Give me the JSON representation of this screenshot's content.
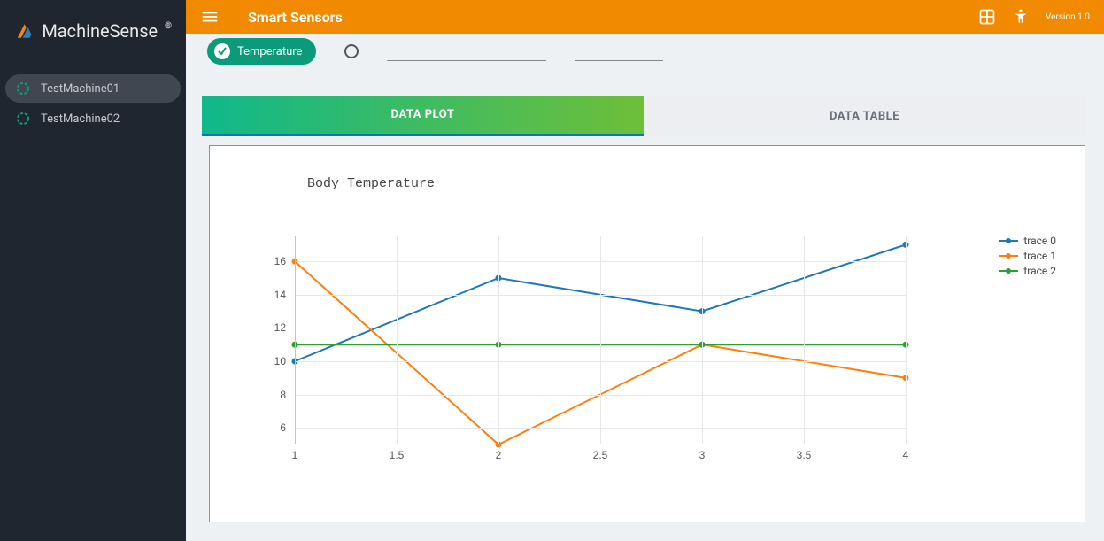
{
  "brand": "MachineSense",
  "header": {
    "title": "Smart Sensors",
    "version": "Version 1.0"
  },
  "sidebar": {
    "items": [
      {
        "label": "TestMachine01",
        "active": true
      },
      {
        "label": "TestMachine02",
        "active": false
      }
    ]
  },
  "subheader": {
    "chip_label": "Temperature",
    "field1": "",
    "field2": ""
  },
  "tabs": [
    {
      "label": "DATA PLOT",
      "active": true
    },
    {
      "label": "DATA TABLE",
      "active": false
    }
  ],
  "chart_data": {
    "type": "line",
    "title": "Body Temperature",
    "xlabel": "",
    "ylabel": "",
    "x": [
      1,
      2,
      3,
      4
    ],
    "x_ticks": [
      1,
      1.5,
      2,
      2.5,
      3,
      3.5,
      4
    ],
    "y_ticks": [
      6,
      8,
      10,
      12,
      14,
      16
    ],
    "xlim": [
      1,
      4
    ],
    "ylim": [
      5,
      17.5
    ],
    "series": [
      {
        "name": "trace 0",
        "color": "#1f77b4",
        "values": [
          10,
          15,
          13,
          17
        ]
      },
      {
        "name": "trace 1",
        "color": "#ff7f0e",
        "values": [
          16,
          5,
          11,
          9
        ]
      },
      {
        "name": "trace 2",
        "color": "#2ca02c",
        "values": [
          11,
          11,
          11,
          11
        ]
      }
    ]
  }
}
